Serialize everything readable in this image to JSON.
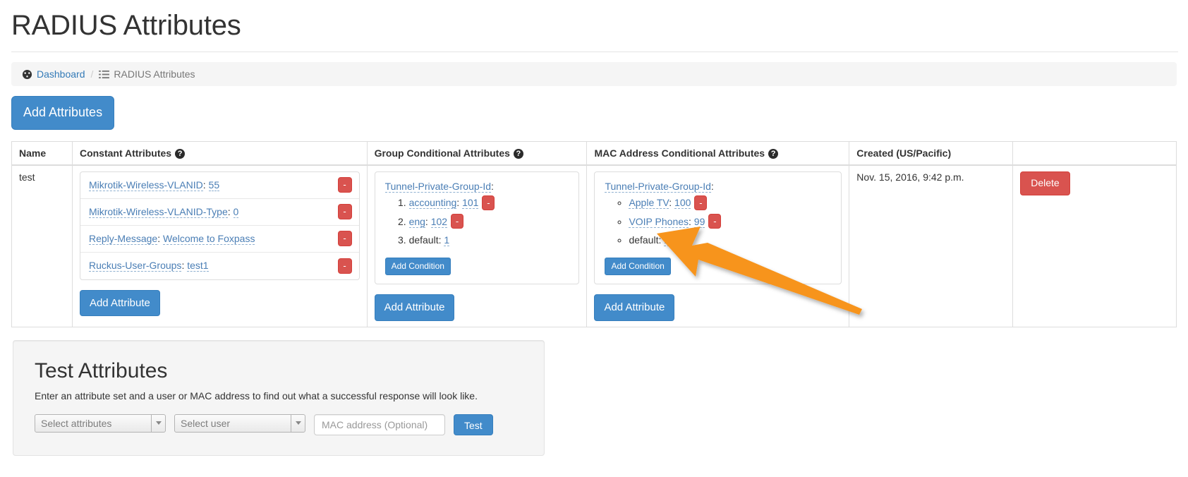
{
  "page": {
    "title": "RADIUS Attributes"
  },
  "breadcrumb": {
    "dashboard_label": "Dashboard",
    "dashboard_icon": "dashboard-tachometer-icon",
    "separator": "/",
    "current_label": "RADIUS Attributes",
    "current_icon": "list-icon"
  },
  "toolbar": {
    "add_attributes_label": "Add Attributes"
  },
  "table": {
    "headers": {
      "name": "Name",
      "constant": "Constant Attributes",
      "group": "Group Conditional Attributes",
      "mac": "MAC Address Conditional Attributes",
      "created": "Created (US/Pacific)",
      "actions": ""
    },
    "help_glyph": "?",
    "row": {
      "name": "test",
      "created": "Nov. 15, 2016, 9:42 p.m.",
      "delete_label": "Delete",
      "minus_label": "-",
      "constant_attributes": [
        {
          "name": "Mikrotik-Wireless-VLANID",
          "value": "55"
        },
        {
          "name": "Mikrotik-Wireless-VLANID-Type",
          "value": "0"
        },
        {
          "name": "Reply-Message",
          "value": "Welcome to Foxpass"
        },
        {
          "name": "Ruckus-User-Groups",
          "value": "test1"
        }
      ],
      "constant_add_label": "Add Attribute",
      "group_conditional": {
        "attribute": "Tunnel-Private-Group-Id",
        "colon": ":",
        "conditions": [
          {
            "key": "accounting",
            "value": "101",
            "removable": true
          },
          {
            "key": "eng",
            "value": "102",
            "removable": true
          },
          {
            "key": "default",
            "value": "1",
            "removable": false
          }
        ],
        "add_condition_label": "Add Condition"
      },
      "group_add_label": "Add Attribute",
      "mac_conditional": {
        "attribute": "Tunnel-Private-Group-Id",
        "colon": ":",
        "conditions": [
          {
            "key": "Apple TV",
            "value": "100",
            "removable": true
          },
          {
            "key": "VOIP Phones",
            "value": "99",
            "removable": true
          },
          {
            "key": "default",
            "value": "1",
            "removable": false
          }
        ],
        "add_condition_label": "Add Condition"
      },
      "mac_add_label": "Add Attribute"
    }
  },
  "test_panel": {
    "heading": "Test Attributes",
    "description": "Enter an attribute set and a user or MAC address to find out what a successful response will look like.",
    "attributes_select_value": "Select attributes",
    "user_select_value": "Select user",
    "mac_placeholder": "MAC address (Optional)",
    "mac_value": "",
    "test_button_label": "Test"
  },
  "annotation": {
    "arrow_color": "#F7941E",
    "points_to": "mac-add-condition-button"
  },
  "colors": {
    "primary": "#428bca",
    "danger": "#d9534f",
    "link": "#337ab7",
    "attr_link": "#4a7eb5",
    "breadcrumb_bg": "#f5f5f5",
    "well_bg": "#f5f5f5"
  }
}
